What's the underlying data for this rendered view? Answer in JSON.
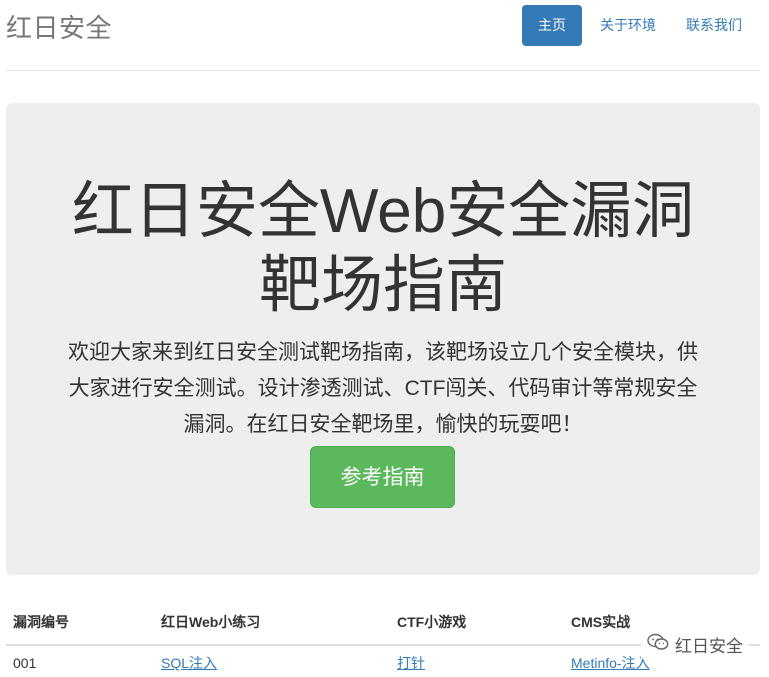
{
  "header": {
    "brand": "红日安全",
    "nav": [
      {
        "label": "主页",
        "active": true
      },
      {
        "label": "关于环境",
        "active": false
      },
      {
        "label": "联系我们",
        "active": false
      }
    ]
  },
  "jumbotron": {
    "title": "红日安全Web安全漏洞靶场指南",
    "description": "欢迎大家来到红日安全测试靶场指南，该靶场设立几个安全模块，供大家进行安全测试。设计渗透测试、CTF闯关、代码审计等常规安全漏洞。在红日安全靶场里，愉快的玩耍吧！",
    "button_label": "参考指南"
  },
  "table": {
    "headers": [
      "漏洞编号",
      "红日Web小练习",
      "CTF小游戏",
      "CMS实战"
    ],
    "rows": [
      [
        "001",
        "SQL注入",
        "打针",
        "Metinfo-注入"
      ]
    ]
  },
  "watermark": {
    "label": "红日安全",
    "icon": "wechat-icon"
  }
}
